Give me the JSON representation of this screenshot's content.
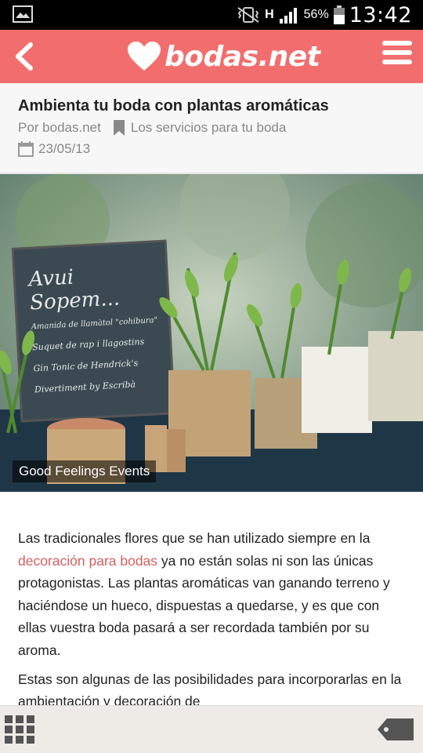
{
  "statusbar": {
    "battery_percent": "56%",
    "time": "13:42",
    "network": "H"
  },
  "appbar": {
    "logo_text": "bodas.net"
  },
  "article": {
    "title": "Ambienta tu boda con plantas aromáticas",
    "author": "Por bodas.net",
    "category": "Los servicios para tu boda",
    "date": "23/05/13"
  },
  "hero": {
    "caption": "Good Feelings Events",
    "sign_lines": [
      "Avui Sopem...",
      "Amanida de llamàtol \"cohibura\"",
      "Suquet de rap i llagostins",
      "Gin Tonic de Hendrick's",
      "Divertiment by Escribà"
    ]
  },
  "content": {
    "p1_before": "Las tradicionales flores que se han utilizado siempre en la ",
    "p1_link": "decoración para bodas",
    "p1_after": " ya no están solas ni son las únicas protagonistas. Las plantas aromáticas van ganando terreno y haciéndose un hueco, dispuestas a quedarse, y es que con ellas vuestra boda pasará a ser recordada también por su aroma.",
    "p2": "Estas son algunas de las posibilidades para incorporarlas en la ambientación y decoración de"
  },
  "colors": {
    "brand": "#f26e6e",
    "link": "#d36060"
  }
}
